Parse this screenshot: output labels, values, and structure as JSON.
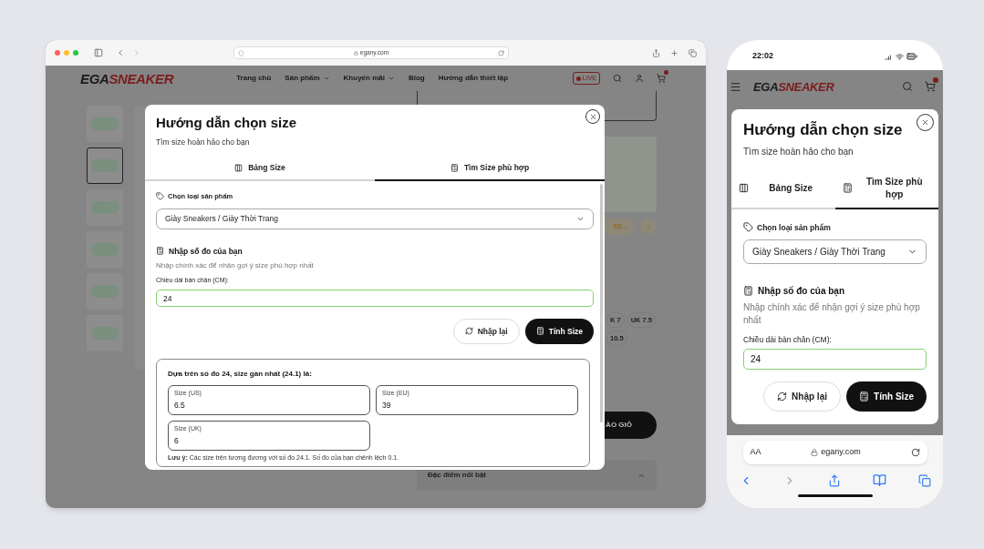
{
  "desktop": {
    "browser": {
      "url": "egany.com"
    },
    "site": {
      "logo": {
        "prefix": "EGA",
        "suffix": "SNEAKER"
      },
      "nav": [
        {
          "label": "Trang chủ",
          "has_menu": false
        },
        {
          "label": "Sản phẩm",
          "has_menu": true
        },
        {
          "label": "Khuyến mãi",
          "has_menu": true
        },
        {
          "label": "Blog",
          "has_menu": false
        },
        {
          "label": "Hướng dẫn thiết lập",
          "has_menu": false
        }
      ],
      "live_badge": "LIVE",
      "thumbnails": [
        {
          "selected": false
        },
        {
          "selected": true
        },
        {
          "selected": false
        },
        {
          "selected": false
        },
        {
          "selected": false
        },
        {
          "selected": false
        }
      ],
      "promo_pill": "EE...",
      "size_pills": [
        "K 7",
        "UK 7.5",
        "10.5"
      ],
      "add_to_cart": "ÀO GIỎ",
      "accordion": {
        "label": "Đặc điểm nổi bật",
        "expanded": true
      }
    },
    "modal": {
      "title": "Hướng dẫn chọn size",
      "subtitle": "Tìm size hoàn hảo cho bạn",
      "tabs": [
        {
          "label": "Bảng Size",
          "kind": "table",
          "selected": false
        },
        {
          "label": "Tìm Size phù hợp",
          "kind": "calc",
          "selected": true
        }
      ],
      "product_type": {
        "label": "Chọn loại sản phẩm",
        "value": "Giày Sneakers / Giày Thời Trang"
      },
      "measure": {
        "heading": "Nhập số đo của bạn",
        "hint": "Nhập chính xác để nhận gợi ý size phù hợp nhất",
        "field_label": "Chiều dài bàn chân (CM):",
        "value": "24"
      },
      "buttons": [
        {
          "label": "Nhập lại",
          "kind": "reset"
        },
        {
          "label": "Tính Size",
          "kind": "calc"
        }
      ],
      "result": {
        "heading": "Dựa trên số đo 24, size gần nhất (24.1) là:",
        "sizes": [
          {
            "label": "Size (US)",
            "value": "6.5"
          },
          {
            "label": "Size (EU)",
            "value": "39"
          },
          {
            "label": "Size (UK)",
            "value": "6"
          }
        ],
        "note": "**Lưu ý:** Các size trên tương đương với số đo 24.1. Số đo của bạn chênh lệch 0.1."
      }
    }
  },
  "mobile": {
    "status_time": "22:02",
    "logo": {
      "prefix": "EGA",
      "suffix": "SNEAKER"
    },
    "modal": {
      "title": "Hướng dẫn chọn size",
      "subtitle": "Tìm size hoàn hảo cho bạn",
      "tabs": [
        {
          "label": "Bảng Size",
          "kind": "table",
          "selected": false
        },
        {
          "label": "Tìm Size phù hợp",
          "kind": "calc",
          "selected": true
        }
      ],
      "product_type": {
        "label": "Chọn loại sản phẩm",
        "value": "Giày Sneakers / Giày Thời Trang"
      },
      "measure": {
        "heading": "Nhập số đo của bạn",
        "hint": "Nhập chính xác để nhận gợi ý size phù hợp nhất",
        "field_label": "Chiều dài bàn chân (CM):",
        "value": "24"
      },
      "buttons": [
        {
          "label": "Nhập lại",
          "kind": "reset"
        },
        {
          "label": "Tính Size",
          "kind": "calc"
        }
      ]
    },
    "url_bar": {
      "text_size": "AA",
      "url": "egany.com"
    }
  }
}
